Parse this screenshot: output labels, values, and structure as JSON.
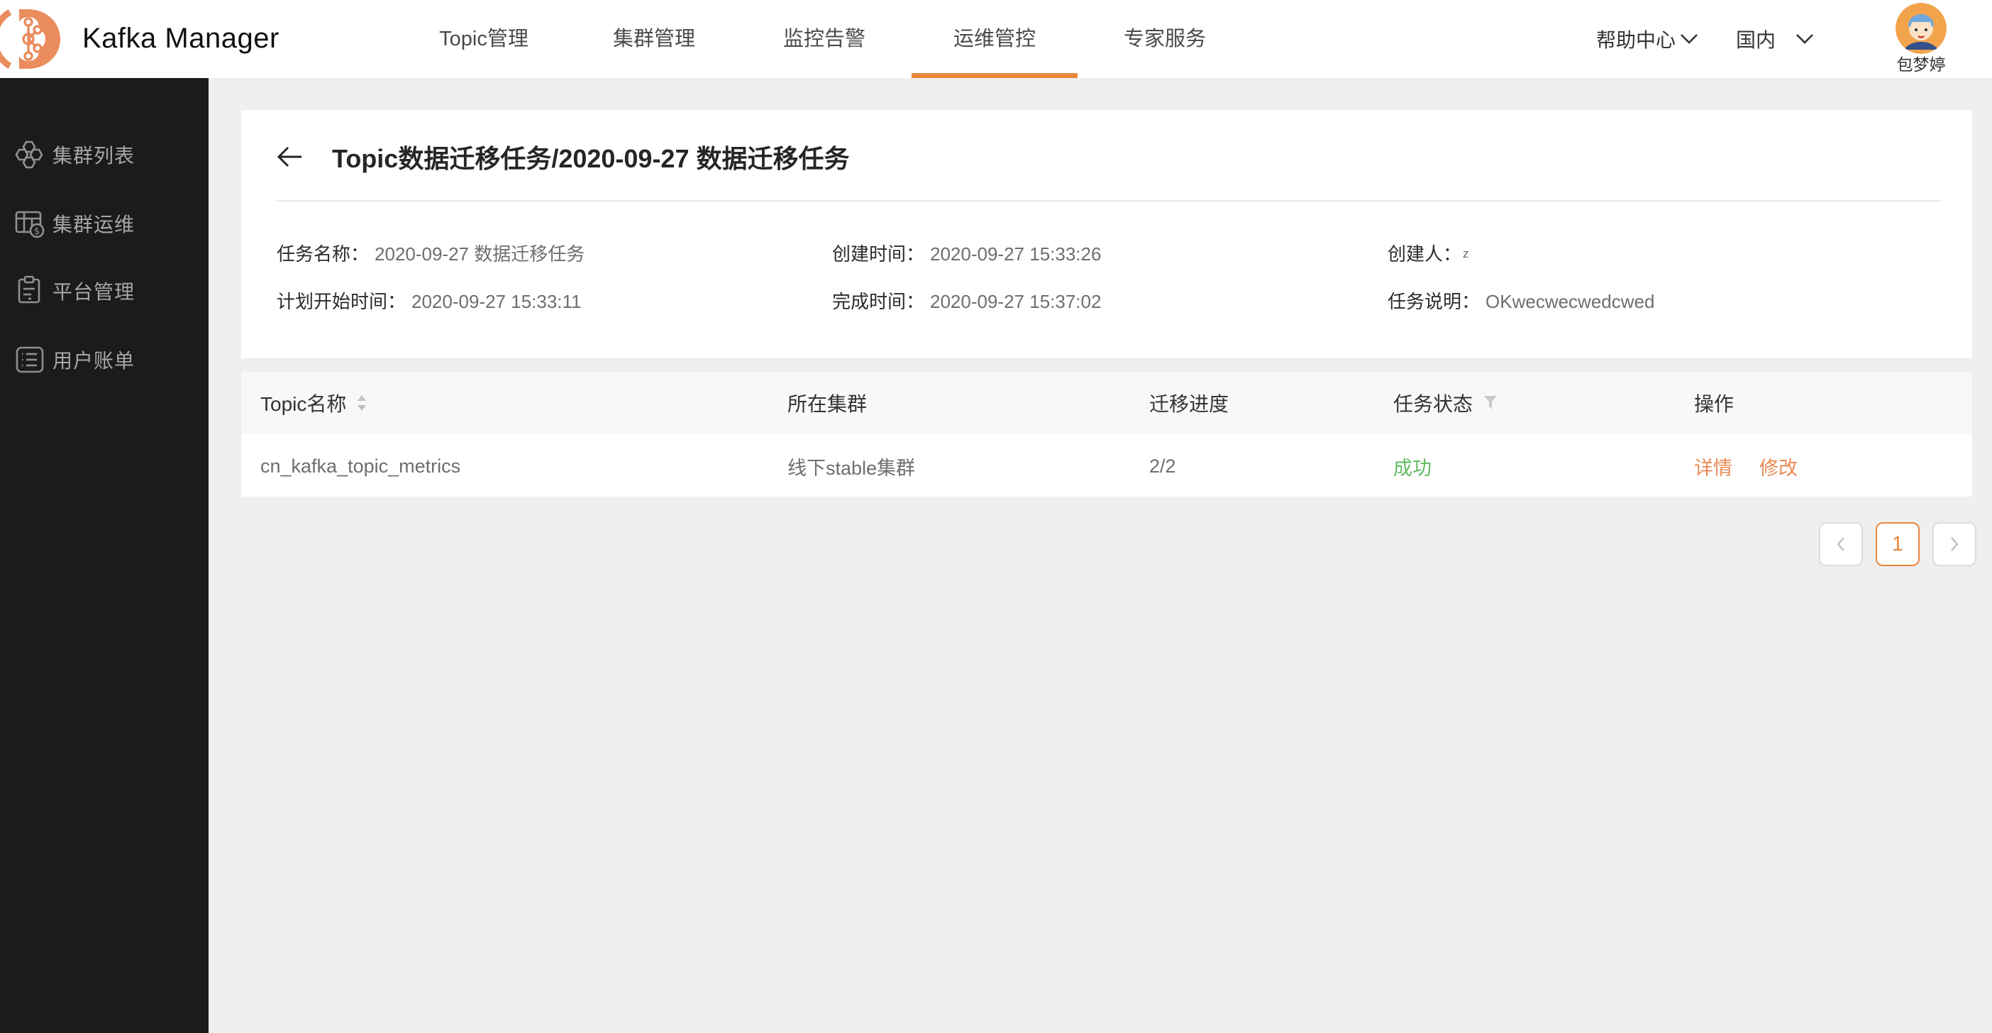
{
  "brand": {
    "title": "Kafka Manager"
  },
  "nav": {
    "tabs": [
      {
        "label": "Topic管理"
      },
      {
        "label": "集群管理"
      },
      {
        "label": "监控告警"
      },
      {
        "label": "运维管控"
      },
      {
        "label": "专家服务"
      }
    ],
    "active_tab": "运维管控"
  },
  "header_right": {
    "help_label": "帮助中心",
    "region_label": "国内",
    "username": "包梦婷"
  },
  "sidebar": {
    "items": [
      {
        "label": "集群列表"
      },
      {
        "label": "集群运维"
      },
      {
        "label": "平台管理"
      },
      {
        "label": "用户账单"
      }
    ]
  },
  "page": {
    "title": "Topic数据迁移任务/2020-09-27 数据迁移任务"
  },
  "details": {
    "fields": [
      {
        "label": "任务名称：",
        "value": "2020-09-27 数据迁移任务"
      },
      {
        "label": "创建时间：",
        "value": "2020-09-27 15:33:26"
      },
      {
        "label": "创建人：",
        "value": "z"
      },
      {
        "label": "计划开始时间：",
        "value": "2020-09-27 15:33:11"
      },
      {
        "label": "完成时间：",
        "value": "2020-09-27 15:37:02"
      },
      {
        "label": "任务说明：",
        "value": "OKwecwecwedcwed"
      }
    ]
  },
  "table": {
    "columns": [
      {
        "label": "Topic名称"
      },
      {
        "label": "所在集群"
      },
      {
        "label": "迁移进度"
      },
      {
        "label": "任务状态"
      },
      {
        "label": "操作"
      }
    ],
    "rows": [
      {
        "topic": "cn_kafka_topic_metrics",
        "cluster": "线下stable集群",
        "progress": "2/2",
        "status": "成功",
        "action_detail": "详情",
        "action_edit": "修改"
      }
    ]
  },
  "pagination": {
    "current_page": "1"
  },
  "colors": {
    "brand_orange": "#e8873d",
    "link_orange": "#ea8b54",
    "status_green": "#5fba60",
    "sidebar_bg": "#1b1b1d",
    "page_bg": "#efeff0"
  }
}
